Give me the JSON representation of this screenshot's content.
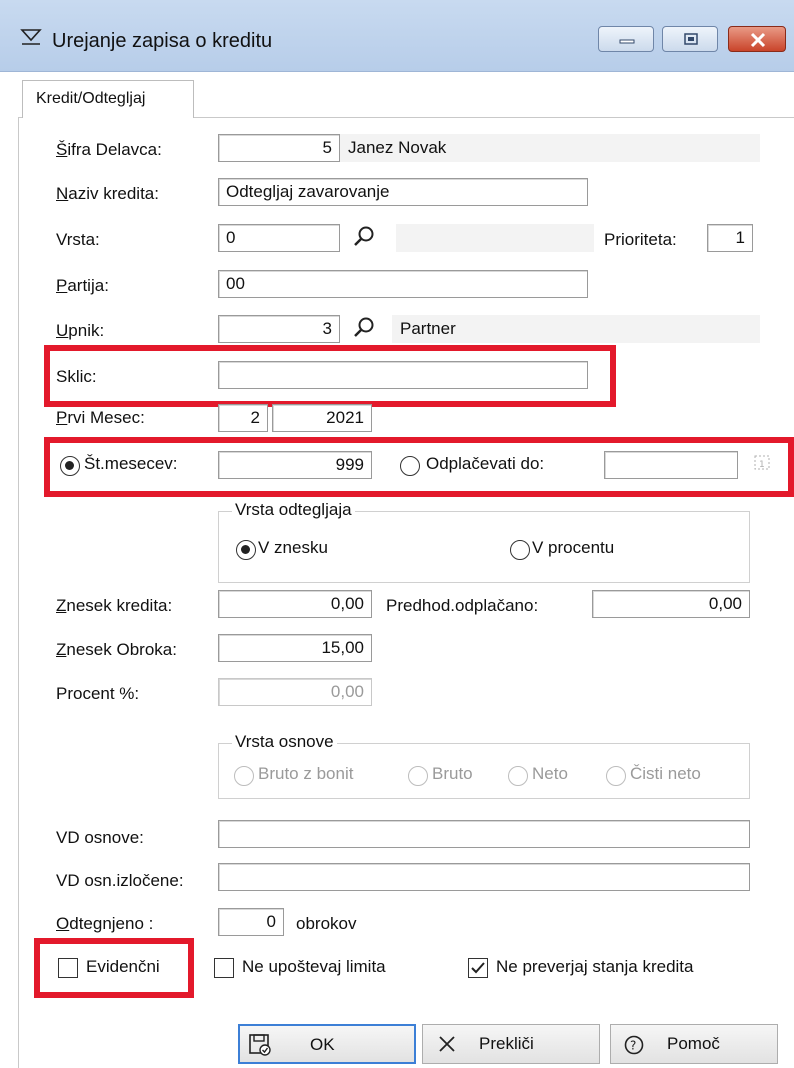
{
  "window": {
    "title": "Urejanje zapisa o kreditu"
  },
  "tab": {
    "label": "Kredit/Odtegljaj"
  },
  "form": {
    "sifra_delavca": {
      "label_first": "Š",
      "label_rest": "ifra Delavca:",
      "value": "5",
      "name": "Janez Novak"
    },
    "naziv_kredita": {
      "label_first": "N",
      "label_rest": "aziv kredita:",
      "value": "Odtegljaj zavarovanje"
    },
    "vrsta": {
      "label": "Vrsta:",
      "value": "0"
    },
    "prioriteta": {
      "label": "Prioriteta:",
      "value": "1"
    },
    "partija": {
      "label_first": "P",
      "label_rest": "artija:",
      "value": "00"
    },
    "upnik": {
      "label_first": "U",
      "label_rest": "pnik:",
      "value": "3",
      "name": "Partner"
    },
    "sklic": {
      "label": "Sklic:",
      "value": ""
    },
    "prvi_mesec": {
      "label_first": "P",
      "label_rest": "rvi Mesec:",
      "month": "2",
      "year": "2021"
    },
    "st_mesecev": {
      "label": "Št.mesecev:",
      "value": "999"
    },
    "odplacevati_do": {
      "label": "Odplačevati do:",
      "value": ""
    },
    "vrsta_odtegljaja": {
      "legend": "Vrsta odtegljaja",
      "opt1": "V znesku",
      "opt2": "V procentu"
    },
    "znesek_kredita": {
      "label_first": "Z",
      "label_rest": "nesek kredita:",
      "value": "0,00"
    },
    "predhod_odplacano": {
      "label": "Predhod.odplačano:",
      "value": "0,00"
    },
    "znesek_obroka": {
      "label_first": "Z",
      "label_rest": "nesek Obroka:",
      "value": "15,00"
    },
    "procent": {
      "label": "Procent %:",
      "value": "0,00"
    },
    "vrsta_osnove": {
      "legend": "Vrsta osnove",
      "opt1": "Bruto z bonit",
      "opt2": "Bruto",
      "opt3": "Neto",
      "opt4": "Čisti neto"
    },
    "vd_osnove": {
      "label": "VD osnove:",
      "value": ""
    },
    "vd_osn_izlocene": {
      "label": "VD osn.izločene:",
      "value": ""
    },
    "odtegnjeno": {
      "label_first": "O",
      "label_rest": "dtegnjeno :",
      "value": "0",
      "suffix": "obrokov"
    },
    "evidencni": {
      "label": "Evidenčni"
    },
    "ne_upostevaj_limita": {
      "label": "Ne upoštevaj limita"
    },
    "ne_preverjaj": {
      "label": "Ne preverjaj stanja kredita"
    }
  },
  "buttons": {
    "ok": "OK",
    "preklici": "Prekliči",
    "pomoc": "Pomoč"
  },
  "colors": {
    "highlight": "#e3192b",
    "titlebar": "#c1d5ee"
  }
}
